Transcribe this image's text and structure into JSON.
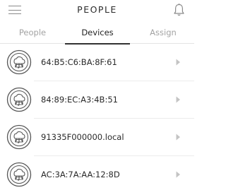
{
  "header": {
    "title": "PEOPLE",
    "menu_icon": "hamburger-menu-icon",
    "bell_icon": "bell-icon"
  },
  "tabs": [
    {
      "label": "People",
      "active": false
    },
    {
      "label": "Devices",
      "active": true
    },
    {
      "label": "Assign",
      "active": false
    }
  ],
  "devices": [
    {
      "name": "64:B5:C6:BA:8F:61",
      "icon": "device-cloud-icon"
    },
    {
      "name": "84:89:EC:A3:4B:51",
      "icon": "device-cloud-icon"
    },
    {
      "name": "91335F000000.local",
      "icon": "device-cloud-icon"
    },
    {
      "name": "AC:3A:7A:AA:12:8D",
      "icon": "device-cloud-icon"
    }
  ],
  "colors": {
    "text": "#2a2a2a",
    "muted": "#a3a3a3",
    "icon": "#555555",
    "chevron": "#b8b8b8"
  }
}
